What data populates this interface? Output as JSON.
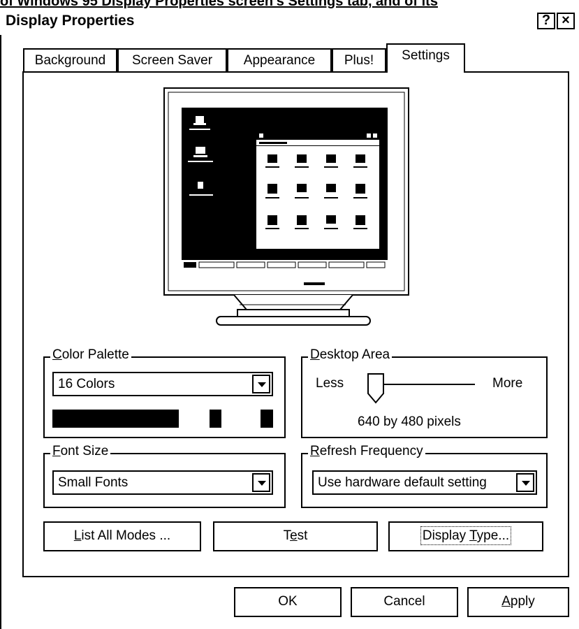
{
  "caption_text": "of Windows 95 Display Properties screen's Settings tab, and of its",
  "window": {
    "title": "Display Properties",
    "help_label": "?",
    "close_label": "×"
  },
  "tabs": [
    {
      "label": "Background",
      "active": false
    },
    {
      "label": "Screen Saver",
      "active": false
    },
    {
      "label": "Appearance",
      "active": false
    },
    {
      "label": "Plus!",
      "active": false
    },
    {
      "label": "Settings",
      "active": true
    }
  ],
  "color_palette": {
    "legend_mnemonic": "C",
    "legend_rest": "olor Palette",
    "selected": "16 Colors"
  },
  "desktop_area": {
    "legend_mnemonic": "D",
    "legend_rest": "esktop Area",
    "less_label": "Less",
    "more_label": "More",
    "resolution": "640 by 480 pixels",
    "slider_level": 0
  },
  "font_size": {
    "legend_mnemonic": "F",
    "legend_rest": "ont Size",
    "selected": "Small Fonts"
  },
  "refresh_frequency": {
    "legend_mnemonic": "R",
    "legend_rest": "efresh Frequency",
    "selected": "Use hardware default setting"
  },
  "buttons": {
    "list_modes_mnemonic": "L",
    "list_modes_rest": "ist All Modes ...",
    "test_pre": "T",
    "test_mnemonic": "e",
    "test_post": "st",
    "display_type_pre": "Display ",
    "display_type_mnemonic": "T",
    "display_type_post": "ype...",
    "ok": "OK",
    "cancel": "Cancel",
    "apply_mnemonic": "A",
    "apply_rest": "pply"
  }
}
